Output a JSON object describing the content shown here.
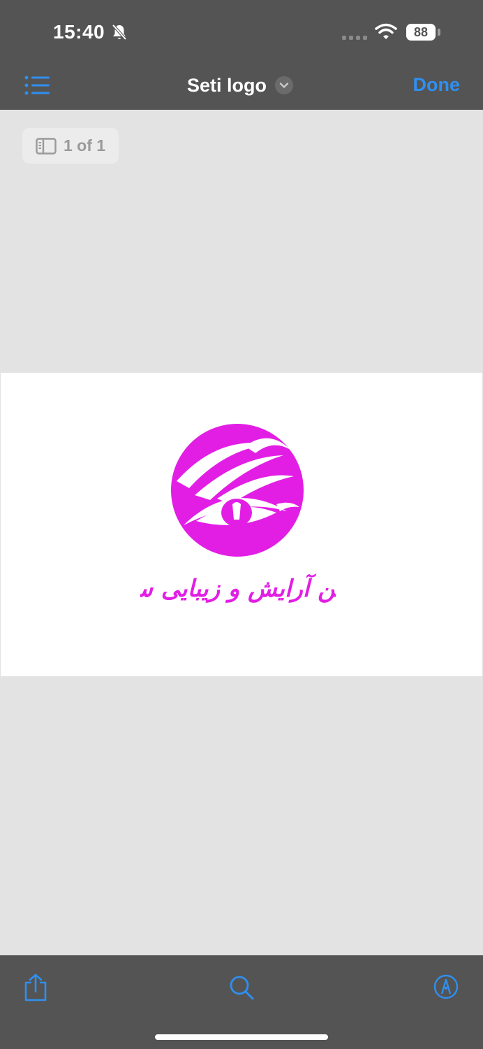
{
  "status_bar": {
    "time": "15:40",
    "battery_level": "88",
    "icons": [
      "bell-muted-icon",
      "signal-icon",
      "wifi-icon",
      "battery-icon"
    ]
  },
  "nav": {
    "title": "Seti logo",
    "done_label": "Done",
    "icons": [
      "list-icon",
      "chevron-down-icon"
    ]
  },
  "page_indicator": {
    "label": "1 of 1",
    "icon": "sidebar-icon"
  },
  "document": {
    "logo_text": "سالن آرایش و زیبایی ستی",
    "logo_color": "#e21ee5"
  },
  "toolbar": {
    "icons": [
      "share-icon",
      "search-icon",
      "markup-icon"
    ]
  },
  "colors": {
    "accent": "#2f8ff0",
    "bar_background": "#545454",
    "content_background": "#e3e3e3"
  }
}
